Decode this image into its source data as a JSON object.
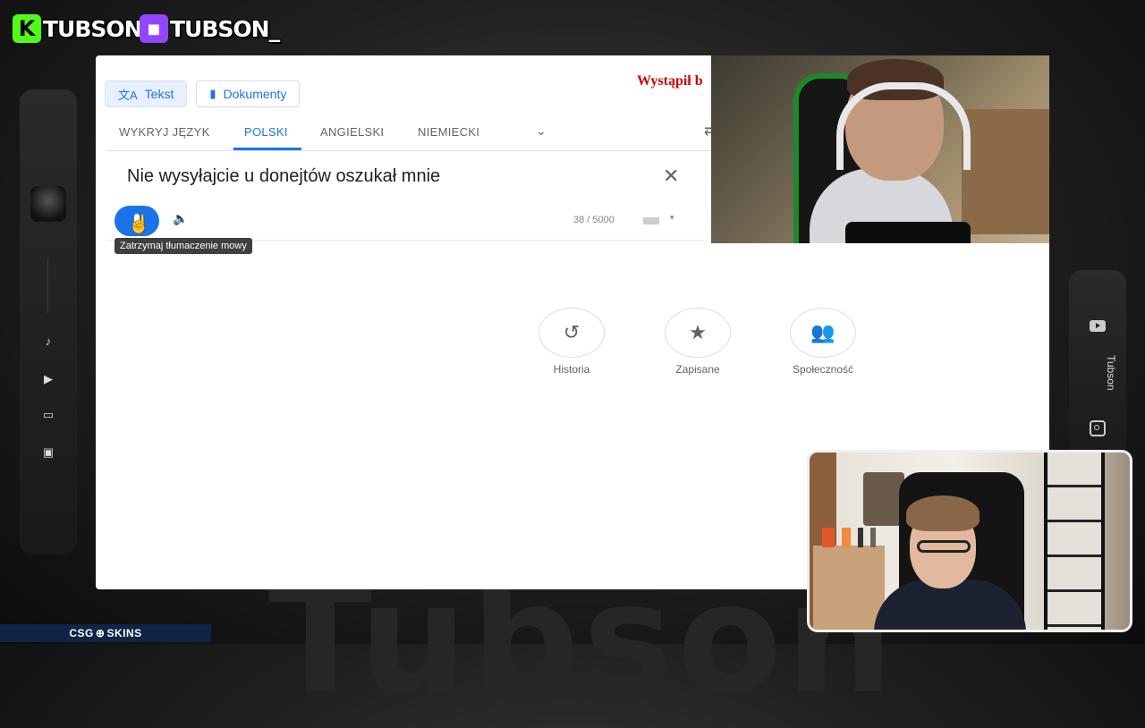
{
  "overlay": {
    "kick_handle": "TUBSON",
    "twitch_handle": "TUBSON_",
    "watermark": "Tubson",
    "right_rail_label": "Tubson",
    "sponsor": "CSG",
    "sponsor_suffix": "SKINS",
    "kick_color": "#53fc18",
    "twitch_color": "#9146ff"
  },
  "translate": {
    "mode_tabs": [
      {
        "label": "Tekst",
        "icon": "translate-icon",
        "active": true
      },
      {
        "label": "Dokumenty",
        "icon": "document-icon",
        "active": false
      }
    ],
    "error_text": "Wystąpił b",
    "source_languages": [
      "WYKRYJ JĘZYK",
      "POLSKI",
      "ANGIELSKI",
      "NIEMIECKI"
    ],
    "active_language": "POLSKI",
    "source_text": "Nie wysyłajcie u donejtów oszukał mnie",
    "char_counter": "38 / 5000",
    "mic_tooltip": "Zatrzymaj tłumaczenie mowy",
    "quick_actions": [
      {
        "label": "Historia",
        "icon": "history-icon"
      },
      {
        "label": "Zapisane",
        "icon": "star-icon"
      },
      {
        "label": "Społeczność",
        "icon": "community-icon"
      }
    ],
    "accent": "#1a73e8"
  }
}
